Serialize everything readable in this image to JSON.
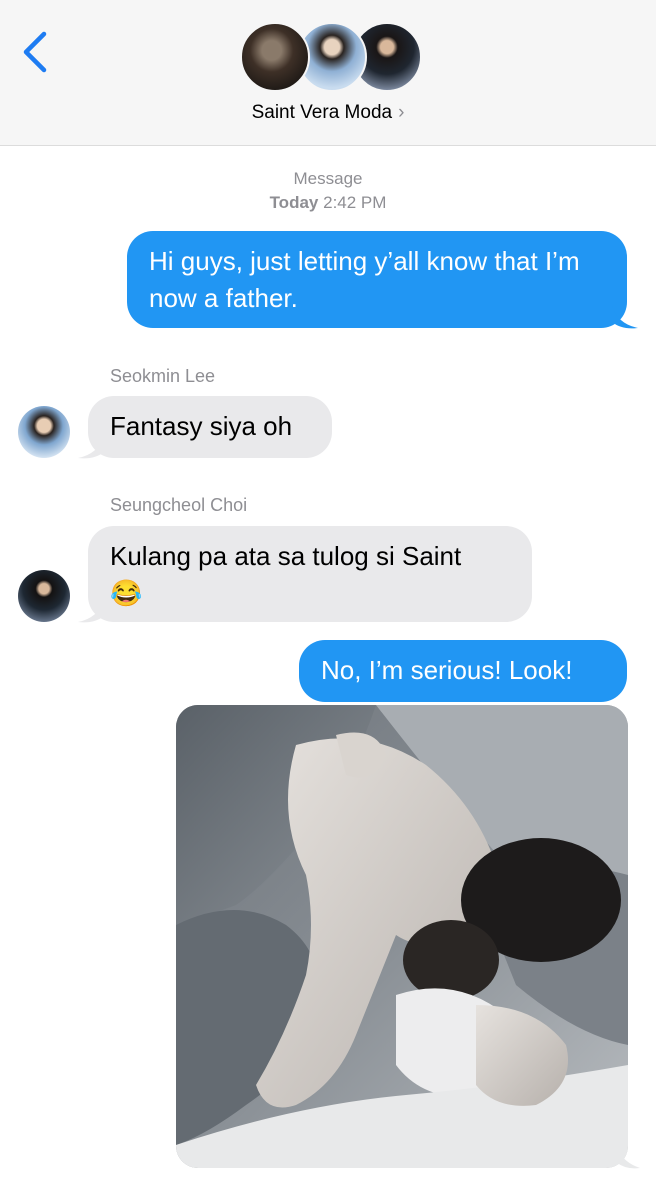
{
  "header": {
    "group_name": "Saint Vera Moda",
    "chevron": "›",
    "back_icon": "chevron-left-icon",
    "accent_color": "#1e7cf2"
  },
  "timestamp": {
    "service": "Message",
    "day": "Today",
    "time": "2:42 PM"
  },
  "messages": [
    {
      "direction": "outgoing",
      "text": "Hi guys, just letting y’all know that I’m now a father."
    },
    {
      "direction": "incoming",
      "sender": "Seokmin Lee",
      "text": "Fantasy siya oh"
    },
    {
      "direction": "incoming",
      "sender": "Seungcheol Choi",
      "text": "Kulang pa ata sa tulog si Saint",
      "emoji": "😂"
    },
    {
      "direction": "outgoing",
      "text": "No, I’m serious! Look!"
    },
    {
      "direction": "outgoing",
      "type": "photo",
      "description_icon": "photo-attachment"
    }
  ],
  "colors": {
    "outgoing_bubble": "#2196f3",
    "incoming_bubble": "#e9e9eb",
    "secondary_text": "#8e8e93"
  }
}
